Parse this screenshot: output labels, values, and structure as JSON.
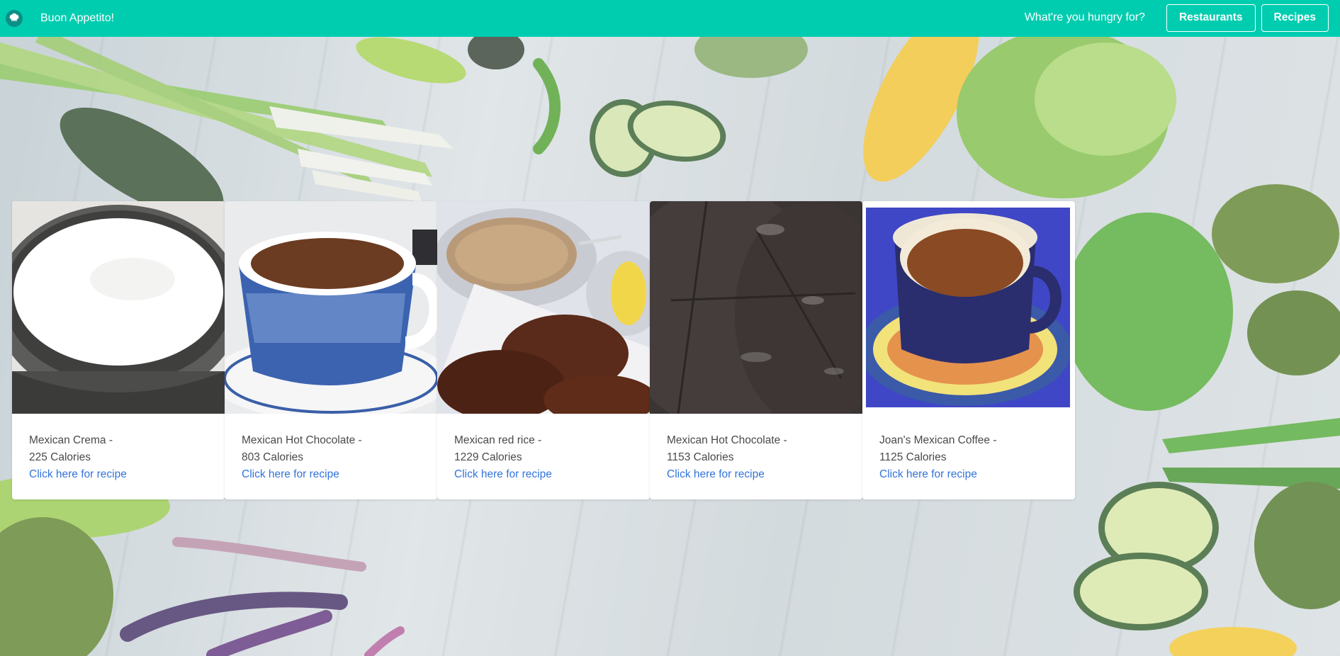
{
  "navbar": {
    "logo_icon": "chef-hat-icon",
    "brand_title": "Buon Appetito!",
    "prompt": "What're you hungry for?",
    "restaurants_label": "Restaurants",
    "recipes_label": "Recipes",
    "accent_color": "#00cdb0"
  },
  "recipes": [
    {
      "name": "Mexican Crema -",
      "calories": "225 Calories",
      "link": "Click here for recipe",
      "image": "white-crema-bowl"
    },
    {
      "name": "Mexican Hot Chocolate -",
      "calories": "803 Calories",
      "link": "Click here for recipe",
      "image": "blue-cup-hot-chocolate"
    },
    {
      "name": "Mexican red rice -",
      "calories": "1229 Calories",
      "link": "Click here for recipe",
      "image": "rice-and-ribs-plate"
    },
    {
      "name": "Mexican Hot Chocolate -",
      "calories": "1153 Calories",
      "link": "Click here for recipe",
      "image": "dark-tortillas"
    },
    {
      "name": "Joan's Mexican Coffee -",
      "calories": "1125 Calories",
      "link": "Click here for recipe",
      "image": "talavera-coffee-cup"
    }
  ],
  "link_color": "#3273dc"
}
